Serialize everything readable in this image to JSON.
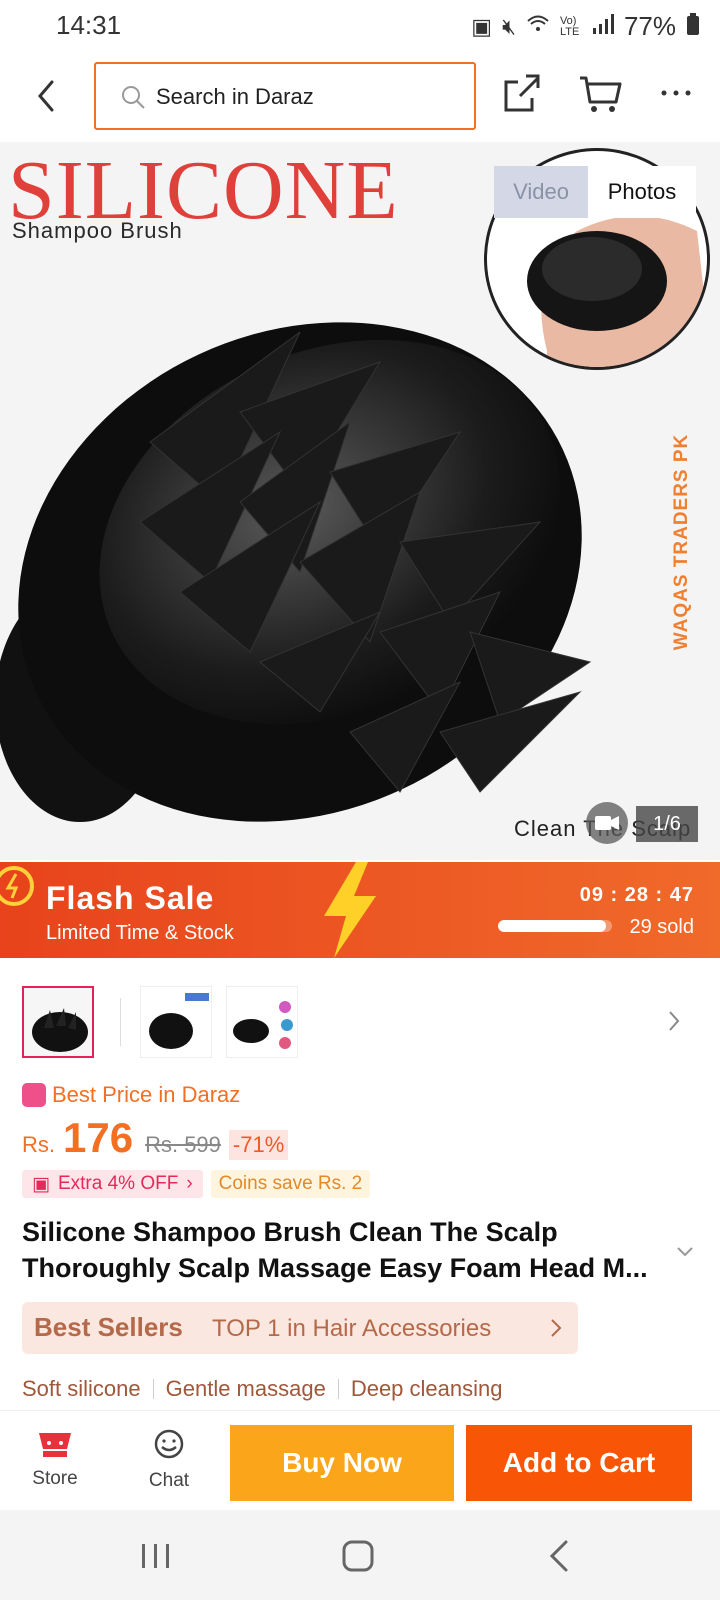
{
  "status_bar": {
    "time": "14:31",
    "network": "Vo) LTE",
    "battery": "77%"
  },
  "search": {
    "placeholder": "Search in Daraz"
  },
  "hero": {
    "title": "SILICONE",
    "subtitle": "Shampoo Brush",
    "watermark": "WAQAS TRADERS PK",
    "caption": "Clean The Scalp",
    "media_tabs": [
      "Video",
      "Photos"
    ],
    "page_counter": "1/6"
  },
  "flash_sale": {
    "title": "Flash Sale",
    "subtitle": "Limited Time & Stock",
    "timer": "09 : 28 : 47",
    "sold": "29 sold",
    "sold_progress": 0.95
  },
  "price": {
    "best_price_label": "Best Price in Daraz",
    "currency": "Rs.",
    "current": "176",
    "original": "Rs. 599",
    "discount": "-71%",
    "extra_off": "Extra 4% OFF",
    "coins": "Coins save Rs. 2"
  },
  "product": {
    "title": "Silicone Shampoo Brush Clean The Scalp Thoroughly Scalp Massage Easy Foam Head M..."
  },
  "best_sellers": {
    "label": "Best Sellers",
    "rank": "TOP 1 in Hair Accessories"
  },
  "features": [
    "Soft silicone",
    "Gentle massage",
    "Deep cleansing"
  ],
  "action_bar": {
    "store_label": "Store",
    "chat_label": "Chat",
    "buy_now_label": "Buy Now",
    "add_to_cart_label": "Add to Cart"
  },
  "colors": {
    "brand_orange": "#f85606",
    "buy_now": "#fba61a",
    "accent_pink": "#e42a5a"
  }
}
